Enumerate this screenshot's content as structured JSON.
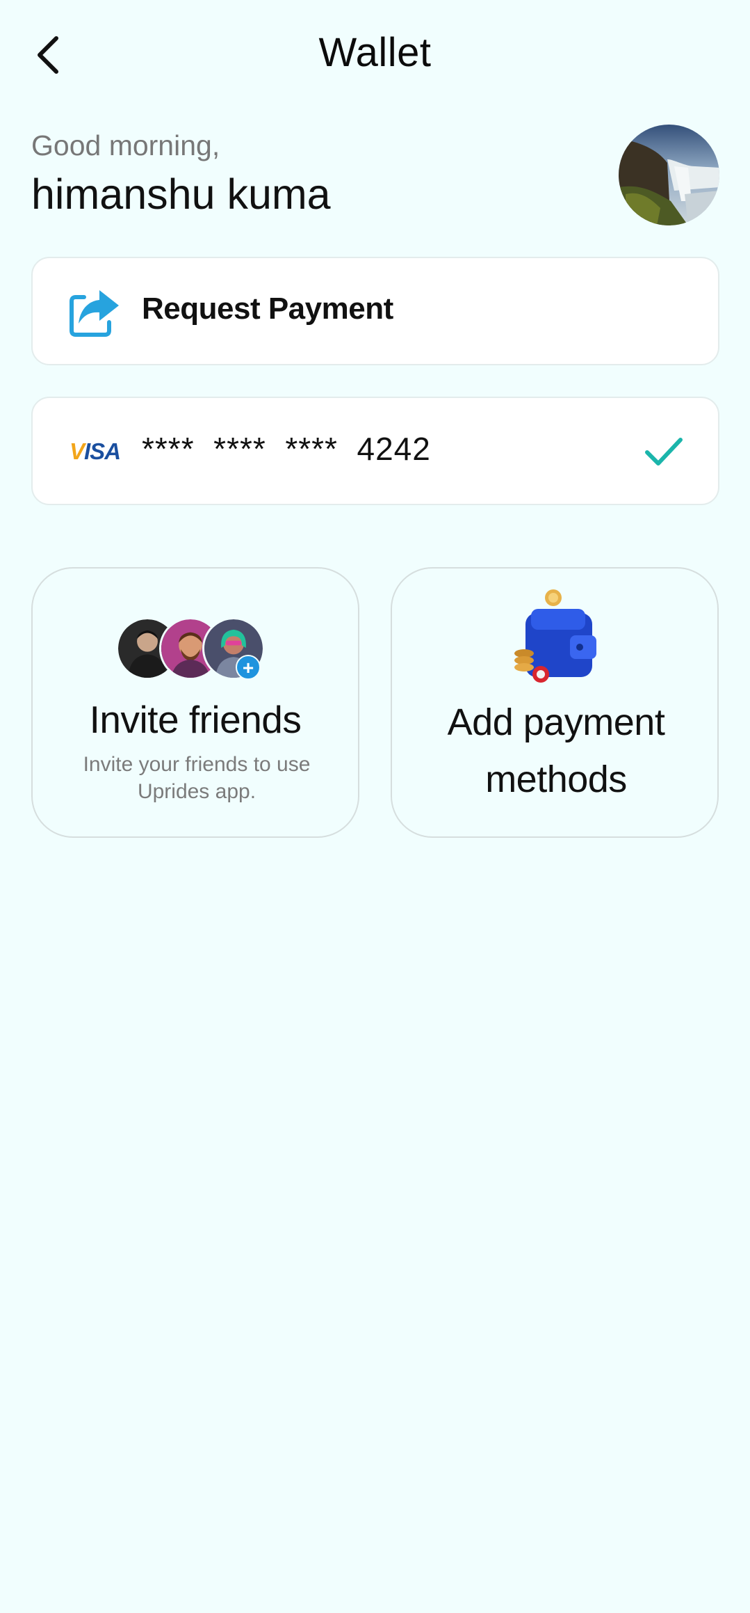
{
  "header": {
    "title": "Wallet",
    "back_icon": "chevron-left-icon"
  },
  "greeting": {
    "salutation": "Good morning,",
    "name": "himanshu kuma"
  },
  "request_payment": {
    "label": "Request Payment",
    "icon": "share-forward-icon"
  },
  "payment_card": {
    "brand": "VISA",
    "masked_number": "****  ****  ****  4242",
    "selected": true,
    "check_color": "#1bb5ab"
  },
  "tiles": {
    "invite": {
      "title": "Invite friends",
      "subtitle": "Invite your friends to use Uprides app."
    },
    "payment": {
      "title": "Add payment methods"
    }
  },
  "colors": {
    "background": "#f1fefe",
    "accent_blue": "#1f93de",
    "visa_blue": "#1a4f9f"
  }
}
